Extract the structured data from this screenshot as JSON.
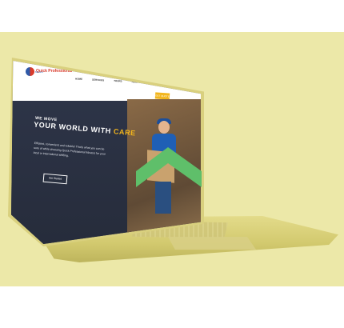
{
  "brand": {
    "name": "Quick Professional",
    "sub": "Movers"
  },
  "nav": {
    "items": [
      "HOME",
      "SERVICES",
      "TOURS",
      "ABOUT US",
      "FAQ",
      "CONTACT US"
    ],
    "cta": "GET QUOTE"
  },
  "hero": {
    "tagline": "WE MOVE",
    "headline_prefix": "YOUR WORLD WITH ",
    "headline_highlight": "CARE",
    "body": "Efficient, convenient and reliable! That's what you can be sure of while choosing Quick Professional Movers for your local or international shifting.",
    "button": "Get Started"
  },
  "colors": {
    "accent": "#f2b51c",
    "hero_bg": "#2d3447",
    "backdrop": "#ece8a8",
    "chevron": "#5fbf6a"
  }
}
